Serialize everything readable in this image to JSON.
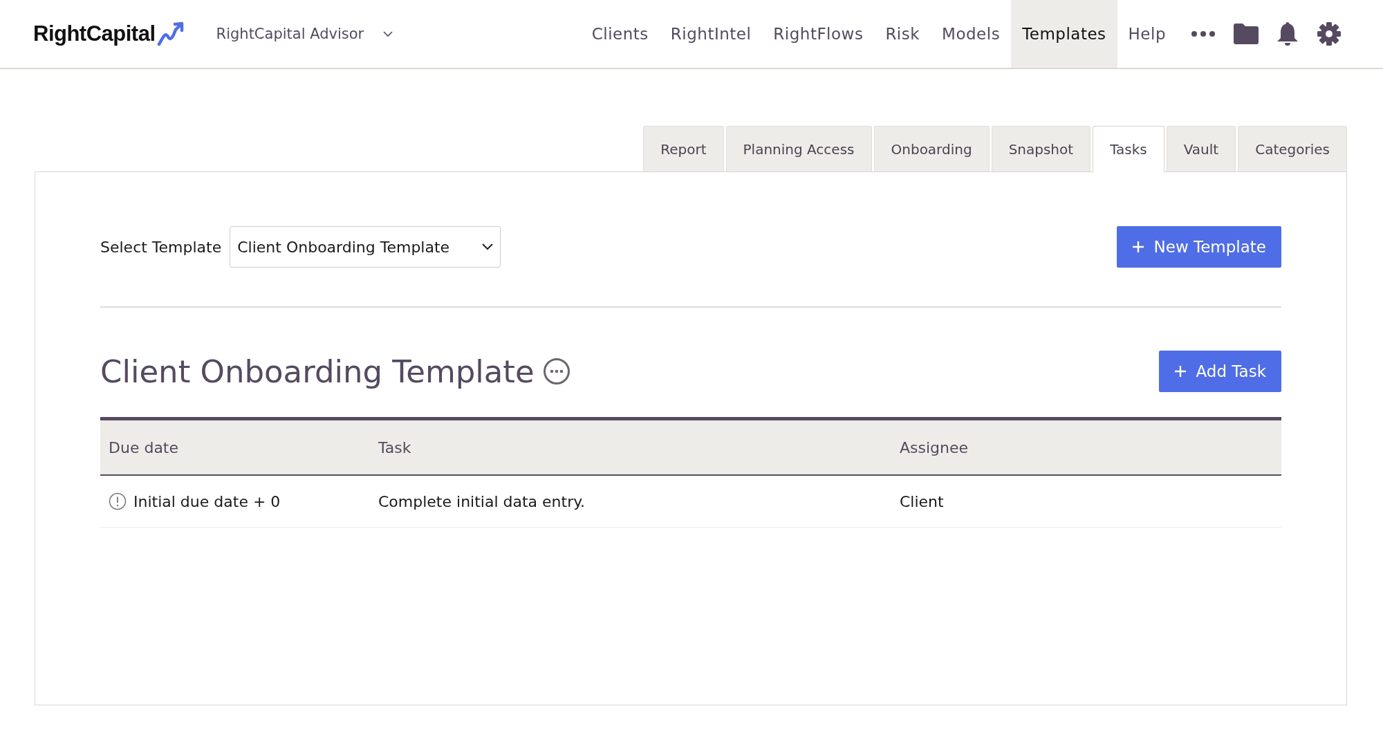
{
  "header": {
    "logo": "RightCapital",
    "account": "RightCapital Advisor",
    "nav": [
      {
        "label": "Clients",
        "selected": false
      },
      {
        "label": "RightIntel",
        "selected": false
      },
      {
        "label": "RightFlows",
        "selected": false
      },
      {
        "label": "Risk",
        "selected": false
      },
      {
        "label": "Models",
        "selected": false
      },
      {
        "label": "Templates",
        "selected": true
      },
      {
        "label": "Help",
        "selected": false
      }
    ]
  },
  "tabs": [
    {
      "label": "Report",
      "selected": false
    },
    {
      "label": "Planning Access",
      "selected": false
    },
    {
      "label": "Onboarding",
      "selected": false
    },
    {
      "label": "Snapshot",
      "selected": false
    },
    {
      "label": "Tasks",
      "selected": true
    },
    {
      "label": "Vault",
      "selected": false
    },
    {
      "label": "Categories",
      "selected": false
    }
  ],
  "select_template": {
    "label": "Select Template",
    "value": "Client Onboarding Template"
  },
  "new_template_button": "New Template",
  "template_title": "Client Onboarding Template",
  "add_task_button": "Add Task",
  "table": {
    "columns": [
      "Due date",
      "Task",
      "Assignee"
    ],
    "rows": [
      {
        "due_date": "Initial due date + 0",
        "task": "Complete initial data entry.",
        "assignee": "Client"
      }
    ]
  }
}
